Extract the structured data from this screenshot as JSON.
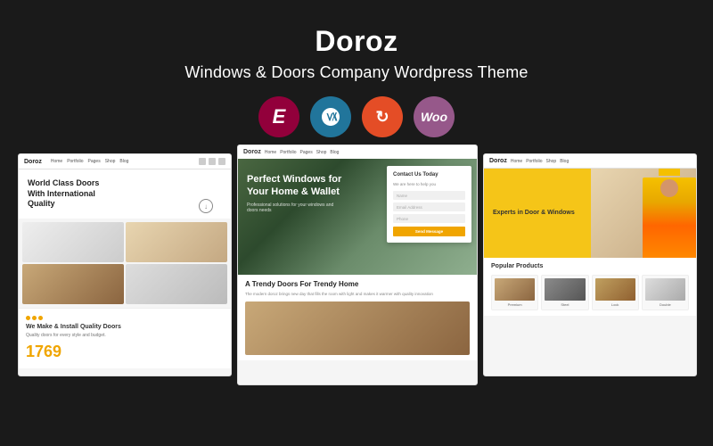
{
  "header": {
    "title": "Doroz",
    "subtitle": "Windows & Doors Company Wordpress Theme"
  },
  "icons": [
    {
      "name": "elementor-icon",
      "label": "E",
      "bg": "#92003b"
    },
    {
      "name": "wordpress-icon",
      "label": "W",
      "bg": "#21759b"
    },
    {
      "name": "redux-icon",
      "label": "↺",
      "bg": "#e44d26"
    },
    {
      "name": "woocommerce-icon",
      "label": "Woo",
      "bg": "#96588a"
    }
  ],
  "screenshots": {
    "left": {
      "logo": "Doroz",
      "hero_title": "World Class Doors With International Quality",
      "bottom_title": "We Make & Install Quality Doors",
      "number": "1769"
    },
    "center": {
      "logo": "Doroz",
      "hero_title": "Perfect Windows for Your Home & Wallet",
      "contact_title": "Contact Us Today",
      "contact_sub": "We are here to help you",
      "field1": "Name",
      "field2": "Email Address",
      "field3": "Phone",
      "btn_label": "Send Message",
      "bottom_title": "A Trendy Doors For Trendy Home"
    },
    "right": {
      "logo": "Doroz",
      "hero_title": "Experts in Door & Windows",
      "products_title": "Popular Products",
      "products": [
        {
          "label": "Premium Door"
        },
        {
          "label": "Steel Door"
        },
        {
          "label": "Door Lock"
        },
        {
          "label": "Double Door"
        }
      ]
    }
  }
}
